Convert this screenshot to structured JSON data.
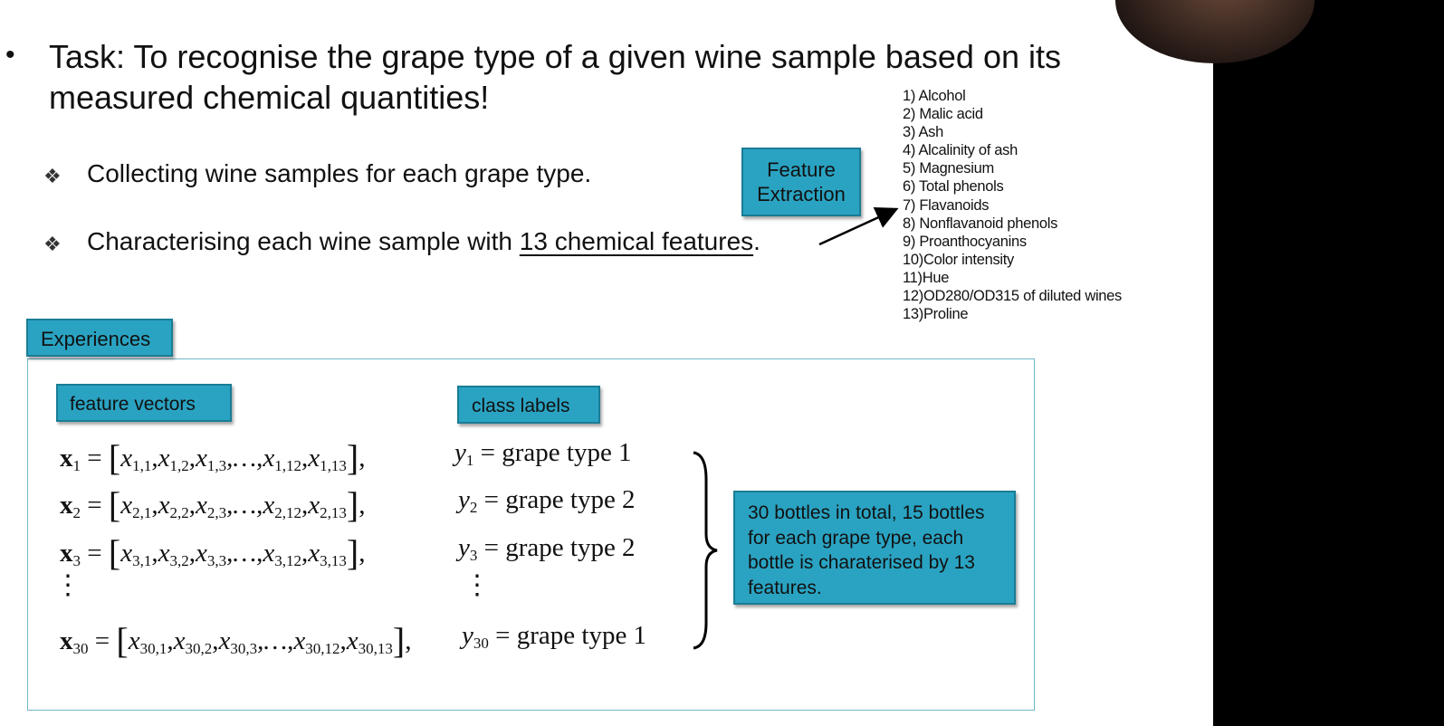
{
  "task": {
    "bullet": "•",
    "text": "Task: To recognise the grape type of a given wine sample based on its measured chemical quantities!"
  },
  "points": [
    {
      "marker": "❖",
      "text": "Collecting wine samples for each grape type."
    },
    {
      "marker": "❖",
      "text_before": "Characterising each wine sample with ",
      "underlined": "13 chemical features",
      "text_after": "."
    }
  ],
  "feature_extraction_label": [
    "Feature",
    "Extraction"
  ],
  "features": [
    "1) Alcohol",
    "2) Malic acid",
    "3) Ash",
    "4) Alcalinity of ash",
    "5) Magnesium",
    "6) Total phenols",
    "7) Flavanoids",
    "8) Nonflavanoid phenols",
    "9) Proanthocyanins",
    "10)Color intensity",
    "11)Hue",
    "12)OD280/OD315 of diluted wines",
    "13)Proline"
  ],
  "experiences": {
    "tab": "Experiences",
    "feature_vectors_label": "feature vectors",
    "class_labels_label": "class labels",
    "rows": [
      {
        "x_bold": "x",
        "x_sub": "1",
        "eq": "=",
        "elements": [
          [
            "x",
            "1,1"
          ],
          [
            "x",
            "1,2"
          ],
          [
            "x",
            "1,3"
          ],
          [
            "…",
            ""
          ],
          [
            "x",
            "1,12"
          ],
          [
            "x",
            "1,13"
          ]
        ],
        "y": "y",
        "y_sub": "1",
        "label": "= grape type 1"
      },
      {
        "x_bold": "x",
        "x_sub": "2",
        "eq": "=",
        "elements": [
          [
            "x",
            "2,1"
          ],
          [
            "x",
            "2,2"
          ],
          [
            "x",
            "2,3"
          ],
          [
            "…",
            ""
          ],
          [
            "x",
            "2,12"
          ],
          [
            "x",
            "2,13"
          ]
        ],
        "y": "y",
        "y_sub": "2",
        "label": "= grape type 2"
      },
      {
        "x_bold": "x",
        "x_sub": "3",
        "eq": "=",
        "elements": [
          [
            "x",
            "3,1"
          ],
          [
            "x",
            "3,2"
          ],
          [
            "x",
            "3,3"
          ],
          [
            "…",
            ""
          ],
          [
            "x",
            "3,12"
          ],
          [
            "x",
            "3,13"
          ]
        ],
        "y": "y",
        "y_sub": "3",
        "label": "= grape type 2"
      },
      {
        "x_bold": "x",
        "x_sub": "30",
        "eq": "=",
        "elements": [
          [
            "x",
            "30,1"
          ],
          [
            "x",
            "30,2"
          ],
          [
            "x",
            "30,3"
          ],
          [
            "…",
            ""
          ],
          [
            "x",
            "30,12"
          ],
          [
            "x",
            "30,13"
          ]
        ],
        "y": "y",
        "y_sub": "30",
        "label": "= grape type 1"
      }
    ],
    "vdots": "⋮",
    "summary": "30 bottles in total, 15 bottles for each grape type, each bottle is charaterised by 13 features."
  }
}
